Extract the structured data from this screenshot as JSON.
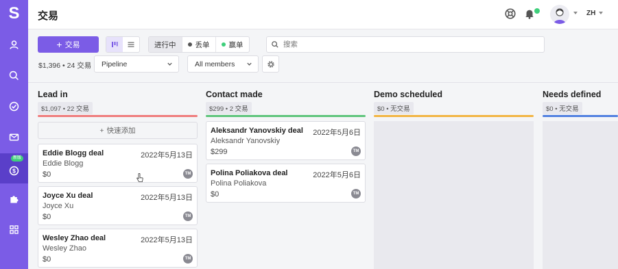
{
  "app": {
    "logo_letter": "S",
    "page_title": "交易",
    "brand_color": "#7b5ce6"
  },
  "sidebar": {
    "items": [
      {
        "icon": "person-icon"
      },
      {
        "icon": "search-icon"
      },
      {
        "icon": "check-circle-icon"
      },
      {
        "icon": "mail-icon"
      },
      {
        "icon": "dollar-circle-icon",
        "active": true,
        "badge": "新版"
      },
      {
        "icon": "puzzle-icon"
      },
      {
        "icon": "apps-grid-icon"
      }
    ]
  },
  "topbar": {
    "language": "ZH"
  },
  "toolbar": {
    "add_label": "交易",
    "statuses": [
      {
        "label": "进行中",
        "selected": true
      },
      {
        "label": "丢单",
        "dot": "#555555"
      },
      {
        "label": "赢单",
        "dot": "#3ecf7b"
      }
    ],
    "search_placeholder": "搜索",
    "summary": "$1,396 • 24 交易",
    "pipeline_select": "Pipeline",
    "members_select": "All members"
  },
  "columns": [
    {
      "name": "Lead in",
      "meta": "$1,097 • 22 交易",
      "color": "#ef7b7b",
      "quick_add": "快速添加",
      "cards": [
        {
          "title": "Eddie Blogg deal",
          "date": "2022年5月13日",
          "person": "Eddie Blogg",
          "amount": "$0",
          "owner": "TM"
        },
        {
          "title": "Joyce Xu deal",
          "date": "2022年5月13日",
          "person": "Joyce Xu",
          "amount": "$0",
          "owner": "TM"
        },
        {
          "title": "Wesley Zhao deal",
          "date": "2022年5月13日",
          "person": "Wesley Zhao",
          "amount": "$0",
          "owner": "TM"
        }
      ]
    },
    {
      "name": "Contact made",
      "meta": "$299 • 2 交易",
      "color": "#5dc47a",
      "cards": [
        {
          "title": "Aleksandr Yanovskiy deal",
          "date": "2022年5月6日",
          "person": "Aleksandr Yanovskiy",
          "amount": "$299",
          "owner": "TM"
        },
        {
          "title": "Polina Poliakova deal",
          "date": "2022年5月6日",
          "person": "Polina Poliakova",
          "amount": "$0",
          "owner": "TM"
        }
      ]
    },
    {
      "name": "Demo scheduled",
      "meta": "$0 • 无交易",
      "color": "#f2b441",
      "cards": []
    },
    {
      "name": "Needs defined",
      "meta": "$0 • 无交易",
      "color": "#4f7fe0",
      "cards": []
    }
  ]
}
